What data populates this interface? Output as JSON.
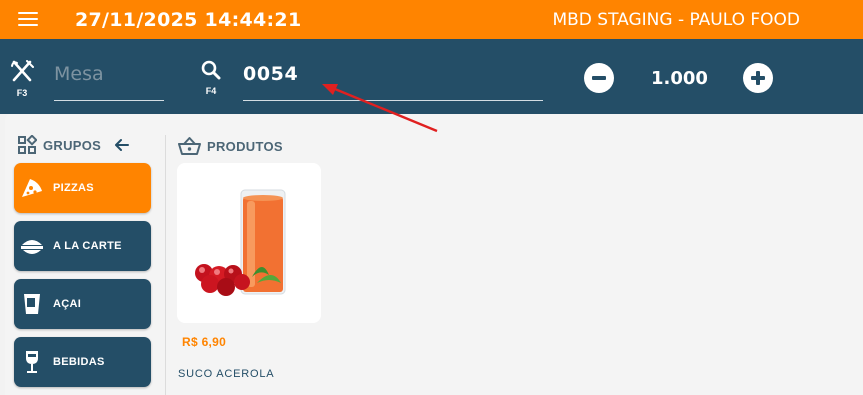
{
  "topbar": {
    "datetime": "27/11/2025 14:44:21",
    "company": "MBD STAGING - PAULO FOOD",
    "menu_icon": "hamburger-menu-icon",
    "bg_color": "#ff8400"
  },
  "toolbar": {
    "bg_color": "#244e67",
    "mesa": {
      "icon": "fork-knife-icon",
      "shortcut": "F3",
      "placeholder": "Mesa"
    },
    "search": {
      "icon": "search-icon",
      "shortcut": "F4",
      "value": "0054"
    },
    "quantity": {
      "value": "1.000",
      "decrement_icon": "minus-circle-icon",
      "increment_icon": "plus-circle-icon"
    }
  },
  "groups": {
    "title": "GRUPOS",
    "title_icon": "grid-icon",
    "back_icon": "arrow-left-icon",
    "items": [
      {
        "label": "PIZZAS",
        "icon": "pizza-icon",
        "active": true
      },
      {
        "label": "A LA CARTE",
        "icon": "food-bowl-icon",
        "active": false
      },
      {
        "label": "AÇAI",
        "icon": "cup-icon",
        "active": false
      },
      {
        "label": "BEBIDAS",
        "icon": "wine-glass-icon",
        "active": false
      }
    ]
  },
  "products": {
    "title": "PRODUTOS",
    "title_icon": "basket-icon",
    "items": [
      {
        "name": "SUCO ACEROLA",
        "price": "R$ 6,90",
        "image_icon": "juice-glass-image"
      }
    ]
  },
  "annotation": {
    "type": "red-arrow",
    "color": "#e02020"
  }
}
